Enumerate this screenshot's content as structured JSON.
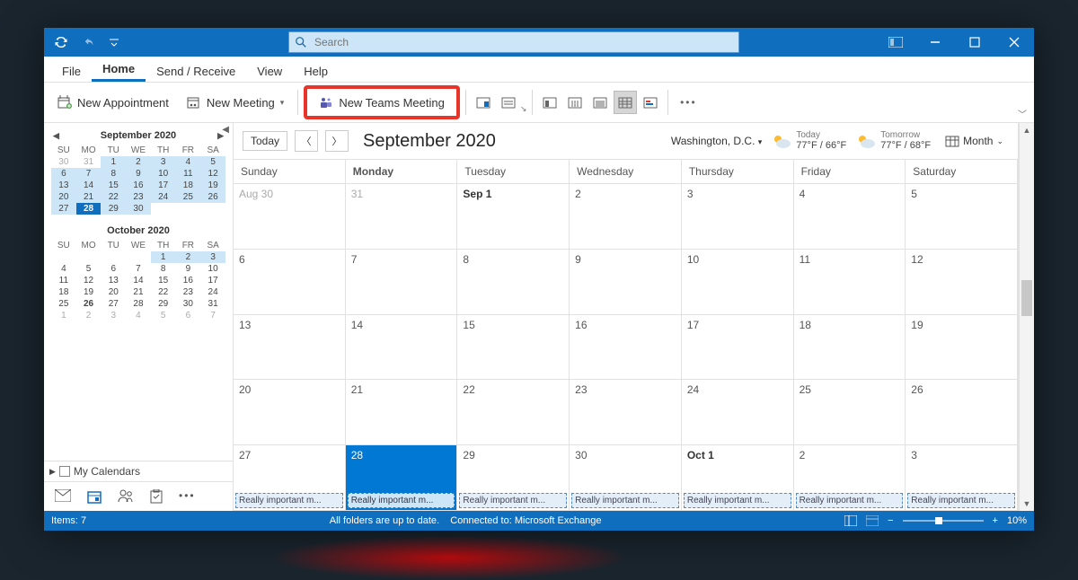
{
  "titlebar": {
    "search_placeholder": "Search"
  },
  "menu": {
    "file": "File",
    "home": "Home",
    "send": "Send / Receive",
    "view": "View",
    "help": "Help"
  },
  "ribbon": {
    "new_appointment": "New Appointment",
    "new_meeting": "New Meeting",
    "new_teams_meeting": "New Teams Meeting"
  },
  "sidebar": {
    "month1": "September 2020",
    "month2": "October 2020",
    "dow": [
      "SU",
      "MO",
      "TU",
      "WE",
      "TH",
      "FR",
      "SA"
    ],
    "sept_cells": [
      [
        "30",
        "d"
      ],
      [
        "31",
        "d"
      ],
      [
        "1",
        "h"
      ],
      [
        "2",
        "h"
      ],
      [
        "3",
        "h"
      ],
      [
        "4",
        "h"
      ],
      [
        "5",
        "h"
      ],
      [
        "6",
        "h"
      ],
      [
        "7",
        "h"
      ],
      [
        "8",
        "h"
      ],
      [
        "9",
        "h"
      ],
      [
        "10",
        "h"
      ],
      [
        "11",
        "h"
      ],
      [
        "12",
        "h"
      ],
      [
        "13",
        "h"
      ],
      [
        "14",
        "h"
      ],
      [
        "15",
        "h"
      ],
      [
        "16",
        "h"
      ],
      [
        "17",
        "h"
      ],
      [
        "18",
        "h"
      ],
      [
        "19",
        "h"
      ],
      [
        "20",
        "h"
      ],
      [
        "21",
        "h"
      ],
      [
        "22",
        "h"
      ],
      [
        "23",
        "h"
      ],
      [
        "24",
        "h"
      ],
      [
        "25",
        "h"
      ],
      [
        "26",
        "h"
      ],
      [
        "27",
        "h"
      ],
      [
        "28",
        "t"
      ],
      [
        "29",
        "h"
      ],
      [
        "30",
        "h"
      ],
      [
        "",
        "e"
      ],
      [
        "",
        "e"
      ],
      [
        "",
        "e"
      ]
    ],
    "oct_cells": [
      [
        "",
        "e"
      ],
      [
        "",
        "e"
      ],
      [
        "",
        "e"
      ],
      [
        "",
        "e"
      ],
      [
        "1",
        "h"
      ],
      [
        "2",
        "h"
      ],
      [
        "3",
        "h"
      ],
      [
        "4",
        ""
      ],
      [
        "5",
        ""
      ],
      [
        "6",
        ""
      ],
      [
        "7",
        ""
      ],
      [
        "8",
        ""
      ],
      [
        "9",
        ""
      ],
      [
        "10",
        ""
      ],
      [
        "11",
        ""
      ],
      [
        "12",
        ""
      ],
      [
        "13",
        ""
      ],
      [
        "14",
        ""
      ],
      [
        "15",
        ""
      ],
      [
        "16",
        ""
      ],
      [
        "17",
        ""
      ],
      [
        "18",
        ""
      ],
      [
        "19",
        ""
      ],
      [
        "20",
        ""
      ],
      [
        "21",
        ""
      ],
      [
        "22",
        ""
      ],
      [
        "23",
        ""
      ],
      [
        "24",
        ""
      ],
      [
        "25",
        ""
      ],
      [
        "26",
        "b"
      ],
      [
        "27",
        ""
      ],
      [
        "28",
        ""
      ],
      [
        "29",
        ""
      ],
      [
        "30",
        ""
      ],
      [
        "31",
        ""
      ],
      [
        "1",
        "d"
      ],
      [
        "2",
        "d"
      ],
      [
        "3",
        "d"
      ],
      [
        "4",
        "d"
      ],
      [
        "5",
        "d"
      ],
      [
        "6",
        "d"
      ],
      [
        "7",
        "d"
      ]
    ],
    "my_calendars": "My Calendars"
  },
  "calendar": {
    "today": "Today",
    "title": "September 2020",
    "location": "Washington, D.C.",
    "weather_today_label": "Today",
    "weather_today_temp": "77°F / 66°F",
    "weather_tom_label": "Tomorrow",
    "weather_tom_temp": "77°F / 68°F",
    "view_label": "Month",
    "day_headers": [
      "Sunday",
      "Monday",
      "Tuesday",
      "Wednesday",
      "Thursday",
      "Friday",
      "Saturday"
    ],
    "event_text": "Really important m...",
    "cells": [
      {
        "n": "Aug 30",
        "dim": 1
      },
      {
        "n": "31",
        "dim": 1
      },
      {
        "n": "Sep 1",
        "bold": 1
      },
      {
        "n": "2"
      },
      {
        "n": "3"
      },
      {
        "n": "4"
      },
      {
        "n": "5"
      },
      {
        "n": "6"
      },
      {
        "n": "7"
      },
      {
        "n": "8"
      },
      {
        "n": "9"
      },
      {
        "n": "10"
      },
      {
        "n": "11"
      },
      {
        "n": "12"
      },
      {
        "n": "13"
      },
      {
        "n": "14"
      },
      {
        "n": "15"
      },
      {
        "n": "16"
      },
      {
        "n": "17"
      },
      {
        "n": "18"
      },
      {
        "n": "19"
      },
      {
        "n": "20"
      },
      {
        "n": "21"
      },
      {
        "n": "22"
      },
      {
        "n": "23"
      },
      {
        "n": "24"
      },
      {
        "n": "25"
      },
      {
        "n": "26"
      },
      {
        "n": "27",
        "ev": 1
      },
      {
        "n": "28",
        "today": 1,
        "ev": 1
      },
      {
        "n": "29",
        "ev": 1
      },
      {
        "n": "30",
        "ev": 1
      },
      {
        "n": "Oct 1",
        "bold": 1,
        "ev": 1
      },
      {
        "n": "2",
        "ev": 1
      },
      {
        "n": "3",
        "ev": 1
      }
    ]
  },
  "status": {
    "items": "Items: 7",
    "folders": "All folders are up to date.",
    "connected": "Connected to: Microsoft Exchange",
    "zoom": "10%"
  }
}
